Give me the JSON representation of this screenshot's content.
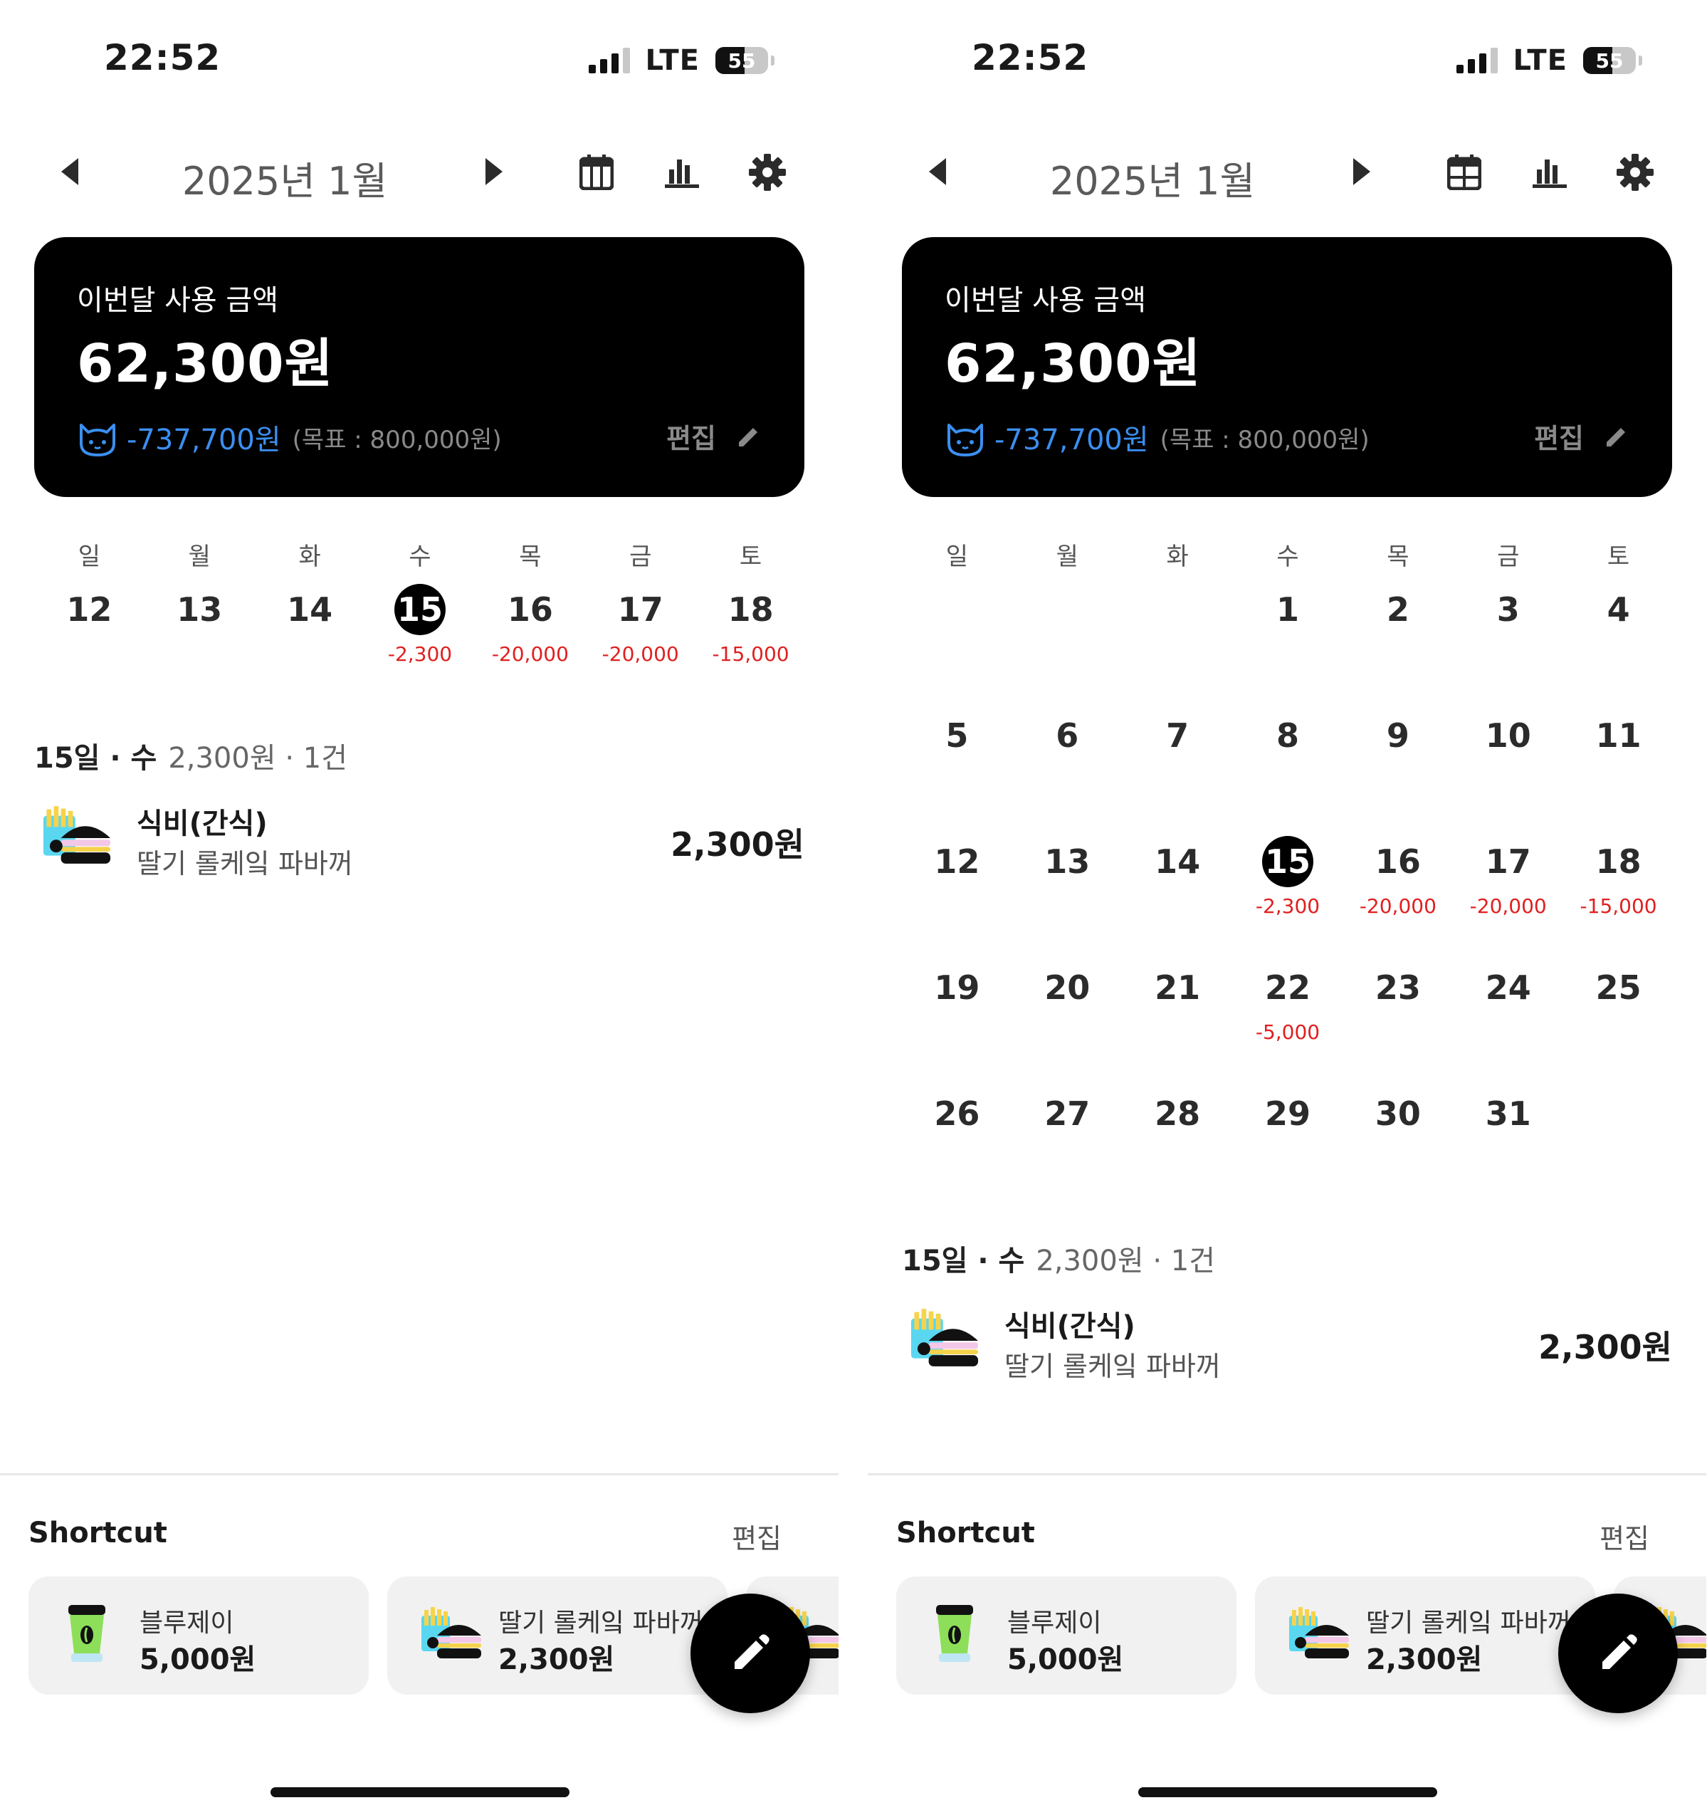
{
  "status": {
    "time": "22:52",
    "network": "LTE",
    "battery": "55",
    "battery_level": 0.55
  },
  "header": {
    "month": "2025년 1월",
    "prev_icon": "triangle-left-icon",
    "next_icon": "triangle-right-icon",
    "calendar_icon": "calendar-icon",
    "chart_icon": "bar-chart-icon",
    "settings_icon": "gear-icon"
  },
  "summary": {
    "label": "이번달 사용 금액",
    "amount": "62,300원",
    "remaining": "-737,700원",
    "goal": "(목표 : 800,000원)",
    "edit_label": "편집",
    "colors": {
      "remaining": "#3b8ff0"
    }
  },
  "weekdays": [
    "일",
    "월",
    "화",
    "수",
    "목",
    "금",
    "토"
  ],
  "week_view": [
    {
      "day": "12",
      "spend": ""
    },
    {
      "day": "13",
      "spend": ""
    },
    {
      "day": "14",
      "spend": ""
    },
    {
      "day": "15",
      "spend": "-2,300",
      "selected": true
    },
    {
      "day": "16",
      "spend": "-20,000"
    },
    {
      "day": "17",
      "spend": "-20,000"
    },
    {
      "day": "18",
      "spend": "-15,000"
    }
  ],
  "month_view": [
    [
      {
        "day": ""
      },
      {
        "day": ""
      },
      {
        "day": ""
      },
      {
        "day": "1"
      },
      {
        "day": "2"
      },
      {
        "day": "3"
      },
      {
        "day": "4"
      }
    ],
    [
      {
        "day": "5"
      },
      {
        "day": "6"
      },
      {
        "day": "7"
      },
      {
        "day": "8"
      },
      {
        "day": "9"
      },
      {
        "day": "10"
      },
      {
        "day": "11"
      }
    ],
    [
      {
        "day": "12"
      },
      {
        "day": "13"
      },
      {
        "day": "14"
      },
      {
        "day": "15",
        "spend": "-2,300",
        "selected": true
      },
      {
        "day": "16",
        "spend": "-20,000"
      },
      {
        "day": "17",
        "spend": "-20,000"
      },
      {
        "day": "18",
        "spend": "-15,000"
      }
    ],
    [
      {
        "day": "19"
      },
      {
        "day": "20"
      },
      {
        "day": "21"
      },
      {
        "day": "22",
        "spend": "-5,000"
      },
      {
        "day": "23"
      },
      {
        "day": "24"
      },
      {
        "day": "25"
      }
    ],
    [
      {
        "day": "26"
      },
      {
        "day": "27"
      },
      {
        "day": "28"
      },
      {
        "day": "29"
      },
      {
        "day": "30"
      },
      {
        "day": "31"
      },
      {
        "day": ""
      }
    ]
  ],
  "day_summary": {
    "date": "15일 · 수",
    "meta": "2,300원 · 1건"
  },
  "transactions": [
    {
      "category": "식비(간식)",
      "memo": "딸기 롤케잌 파바꺼",
      "amount": "2,300원",
      "icon": "burger-fries-icon"
    }
  ],
  "shortcut": {
    "title": "Shortcut",
    "edit_label": "편집",
    "items": [
      {
        "name": "블루제이",
        "amount": "5,000원",
        "icon": "coffee-cup-icon"
      },
      {
        "name": "딸기 롤케잌 파바꺼",
        "amount": "2,300원",
        "icon": "burger-fries-icon"
      }
    ]
  },
  "fab_icon": "pencil-icon",
  "colors": {
    "spend": "#e02020",
    "card_bg": "#000000"
  }
}
